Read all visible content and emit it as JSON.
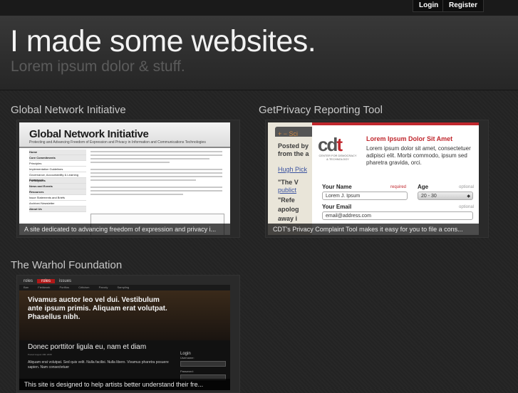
{
  "header": {
    "login_label": "Login",
    "register_label": "Register",
    "title": "I made some websites.",
    "tagline": "Lorem ipsum dolor & stuff."
  },
  "colors": {
    "background": "#242424",
    "accent_red": "#c0272d",
    "title_text": "#f2f2f2",
    "tagline_text": "#5b5b5b"
  },
  "projects": [
    {
      "title": "Global Network Initiative",
      "caption": "A site dedicated to advancing freedom of expression and privacy i...",
      "screenshot": {
        "site_title": "Global Network Initiative",
        "site_subtitle": "Protecting and Advancing Freedom of Expression and Privacy in Information and Communications Technologies",
        "nav": [
          "Home",
          "Core Commitments",
          "Principles",
          "Implementation Guidelines",
          "Governance, Accountability & Learning Framework",
          "Participants",
          "News and Events",
          "Resources",
          "Issue Statements and Briefs",
          "Archived Newsletter",
          "About Us"
        ]
      }
    },
    {
      "title": "GetPrivacy Reporting Tool",
      "caption": "CDT's Privacy Complaint Tool makes it easy for you to file a cons...",
      "screenshot": {
        "left_lines": [
          "Posted by",
          "from the a",
          "Hugh Pick",
          "\"The V",
          "publict",
          "\"Refe",
          "apolog",
          "away i"
        ],
        "logo_text": "cdt",
        "logo_small": "CENTER FOR DEMOCRACY & TECHNOLOGY",
        "heading": "Lorem Ipsum Dolor Sit Amet",
        "paragraph": "Lorem ipsum dolor sit amet, consectetuer adipisci elit. Morbi commodo, ipsum sed pharetra gravida, orci.",
        "name_label": "Your Name",
        "name_required": "required",
        "name_value": "Lorem J. Ipsum",
        "age_label": "Age",
        "age_optional": "optional",
        "age_value": "20 - 30",
        "email_label": "Your Email",
        "email_optional": "optional",
        "email_value": "email@address.com"
      }
    },
    {
      "title": "The Warhol Foundation",
      "caption": "This site is designed to help artists better understand their fre...",
      "screenshot": {
        "tabs": [
          "roles",
          "roles",
          "issues"
        ],
        "nav": [
          "Ban",
          "Fieldwork",
          "Portfios",
          "Criticism",
          "Parody",
          "Sampling"
        ],
        "hero": "Vivamus auctor leo vel dui. Vestibulum ante ipsum primis. Aliquam erat volutpat. Phasellus nibh.",
        "post_title": "Donec porttitor ligula eu, nam et diam",
        "post_meta": "Posted August 18th 2008",
        "post_text": "Aliquam erat volutpat. Sed quis velit. Nulla facilisi. Nulla libero. Vivamus pharetra posuere sapien. Nam consectetuer",
        "login_label": "Login",
        "username_label": "Username:",
        "password_label": "Password:"
      }
    }
  ]
}
